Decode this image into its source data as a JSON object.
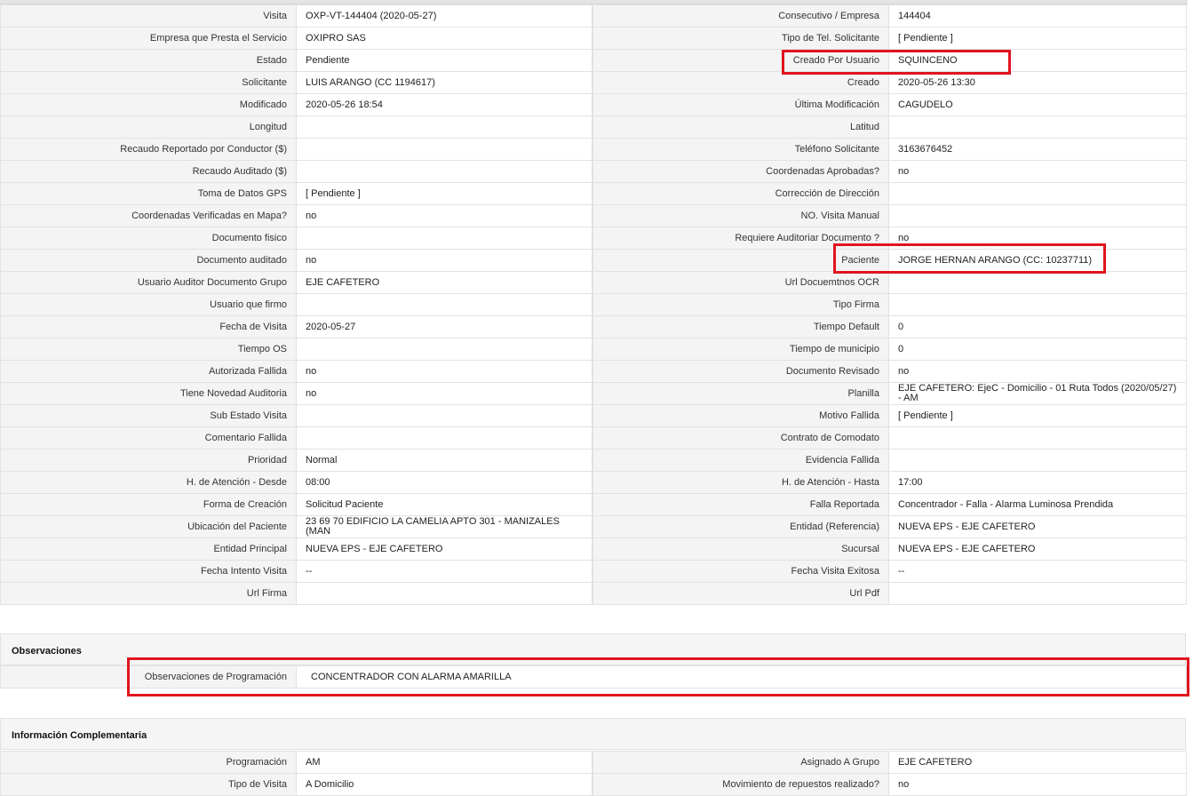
{
  "main_rows": [
    {
      "l1": "Visita",
      "v1": "OXP-VT-144404 (2020-05-27)",
      "l2": "Consecutivo / Empresa",
      "v2": "144404"
    },
    {
      "l1": "Empresa que Presta el Servicio",
      "v1": "OXIPRO SAS",
      "l2": "Tipo de Tel. Solicitante",
      "v2": "[ Pendiente ]"
    },
    {
      "l1": "Estado",
      "v1": "Pendiente",
      "l2": "Creado Por Usuario",
      "v2": "SQUINCENO"
    },
    {
      "l1": "Solicitante",
      "v1": "LUIS ARANGO (CC 1194617)",
      "l2": "Creado",
      "v2": "2020-05-26 13:30"
    },
    {
      "l1": "Modificado",
      "v1": "2020-05-26 18:54",
      "l2": "Última Modificación",
      "v2": " CAGUDELO"
    },
    {
      "l1": "Longitud",
      "v1": "",
      "l2": "Latitud",
      "v2": ""
    },
    {
      "l1": "Recaudo Reportado por Conductor ($)",
      "v1": "",
      "l2": "Teléfono Solicitante",
      "v2": "3163676452"
    },
    {
      "l1": "Recaudo Auditado ($)",
      "v1": "",
      "l2": "Coordenadas Aprobadas?",
      "v2": " no"
    },
    {
      "l1": "Toma de Datos GPS",
      "v1": "[ Pendiente ]",
      "l2": "Corrección de Dirección",
      "v2": ""
    },
    {
      "l1": "Coordenadas Verificadas en Mapa?",
      "v1": " no",
      "l2": "NO. Visita Manual",
      "v2": ""
    },
    {
      "l1": "Documento fisico",
      "v1": "",
      "l2": "Requiere Auditoriar Documento ?",
      "v2": " no"
    },
    {
      "l1": "Documento auditado",
      "v1": " no",
      "l2": "Paciente",
      "v2": "JORGE HERNAN ARANGO (CC: 10237711)"
    },
    {
      "l1": "Usuario Auditor Documento Grupo",
      "v1": "EJE CAFETERO",
      "l2": "Url Docuemtnos OCR",
      "v2": ""
    },
    {
      "l1": "Usuario que firmo",
      "v1": "",
      "l2": "Tipo Firma",
      "v2": ""
    },
    {
      "l1": "Fecha de Visita",
      "v1": " 2020-05-27",
      "l2": "Tiempo Default",
      "v2": "0"
    },
    {
      "l1": "Tiempo OS",
      "v1": "",
      "l2": "Tiempo de municipio",
      "v2": "0"
    },
    {
      "l1": "Autorizada Fallida",
      "v1": " no",
      "l2": "Documento Revisado",
      "v2": " no"
    },
    {
      "l1": "Tiene Novedad Auditoria",
      "v1": " no",
      "l2": "Planilla",
      "v2": "EJE CAFETERO: EjeC - Domicilio - 01 Ruta Todos (2020/05/27) - AM"
    },
    {
      "l1": "Sub Estado Visita",
      "v1": "",
      "l2": "Motivo Fallida",
      "v2": "[ Pendiente ]"
    },
    {
      "l1": "Comentario Fallida",
      "v1": "",
      "l2": "Contrato de Comodato",
      "v2": ""
    },
    {
      "l1": "Prioridad",
      "v1": "Normal",
      "l2": "Evidencia Fallida",
      "v2": ""
    },
    {
      "l1": "H. de Atención - Desde",
      "v1": "08:00",
      "l2": "H. de Atención - Hasta",
      "v2": "17:00"
    },
    {
      "l1": "Forma de Creación",
      "v1": "Solicitud Paciente",
      "l2": "Falla Reportada",
      "v2": "Concentrador - Falla - Alarma Luminosa Prendida"
    },
    {
      "l1": "Ubicación del Paciente",
      "v1": "23 69 70 EDIFICIO LA CAMELIA APTO 301 - MANIZALES (MAN",
      "l2": "Entidad (Referencia)",
      "v2": "NUEVA EPS - EJE CAFETERO"
    },
    {
      "l1": "Entidad Principal",
      "v1": "NUEVA EPS - EJE CAFETERO",
      "l2": "Sucursal",
      "v2": "NUEVA EPS - EJE CAFETERO"
    },
    {
      "l1": "Fecha Intento Visita",
      "v1": " --",
      "l2": "Fecha Visita Exitosa",
      "v2": " --"
    },
    {
      "l1": "Url Firma",
      "v1": "",
      "l2": "Url Pdf",
      "v2": ""
    }
  ],
  "observaciones": {
    "title": "Observaciones",
    "label": "Observaciones de Programación",
    "value": "CONCENTRADOR CON ALARMA AMARILLA"
  },
  "complementaria": {
    "title": "Información Complementaria",
    "rows": [
      {
        "l1": "Programación",
        "v1": "AM",
        "l2": "Asignado A Grupo",
        "v2": "EJE CAFETERO"
      },
      {
        "l1": "Tipo de Visita",
        "v1": "A Domicilio",
        "l2": "Movimiento de repuestos realizado?",
        "v2": " no"
      }
    ]
  },
  "highlight_color": "#e0141e"
}
